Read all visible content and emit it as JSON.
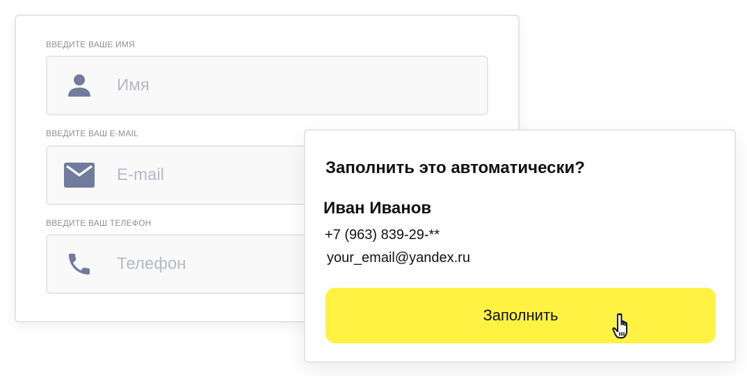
{
  "form": {
    "name": {
      "label": "Введите ваше имя",
      "placeholder": "Имя",
      "icon": "user-icon"
    },
    "email": {
      "label": "Введите ваш e-mail",
      "placeholder": "E-mail",
      "icon": "envelope-icon"
    },
    "phone": {
      "label": "Введите ваш телефон",
      "placeholder": "Телефон",
      "icon": "phone-icon"
    }
  },
  "popup": {
    "title": "Заполнить это автоматически?",
    "name": "Иван Иванов",
    "phone": "+7 (963) 839-29-**",
    "email": "your_email@yandex.ru",
    "button_label": "Заполнить"
  },
  "colors": {
    "icon": "#717c9c",
    "button_bg": "#fff243",
    "placeholder": "#b6bac4",
    "label": "#8a8f99"
  }
}
